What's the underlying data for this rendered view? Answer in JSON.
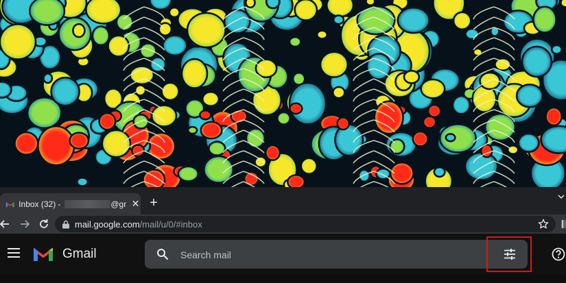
{
  "browser": {
    "tab": {
      "title_prefix": "Inbox (32) - ",
      "title_suffix": "@gn",
      "close_glyph": "✕"
    },
    "new_tab_glyph": "+",
    "address": {
      "host": "mail.google.com",
      "path": "/mail/u/0/#inbox"
    }
  },
  "gmail": {
    "product_name": "Gmail",
    "search": {
      "placeholder": "Search mail"
    }
  },
  "icons": {
    "tab_favicon": "gmail-favicon",
    "back": "arrow-left",
    "forward": "arrow-right",
    "reload": "reload",
    "lock": "lock",
    "bookmark": "star-outline",
    "menu": "hamburger",
    "search": "magnifier",
    "search_options": "tune-sliders",
    "help": "question-circle"
  },
  "colors": {
    "highlight": "#d11a1a",
    "header_bg": "#111111",
    "search_bg": "#3c4043"
  }
}
